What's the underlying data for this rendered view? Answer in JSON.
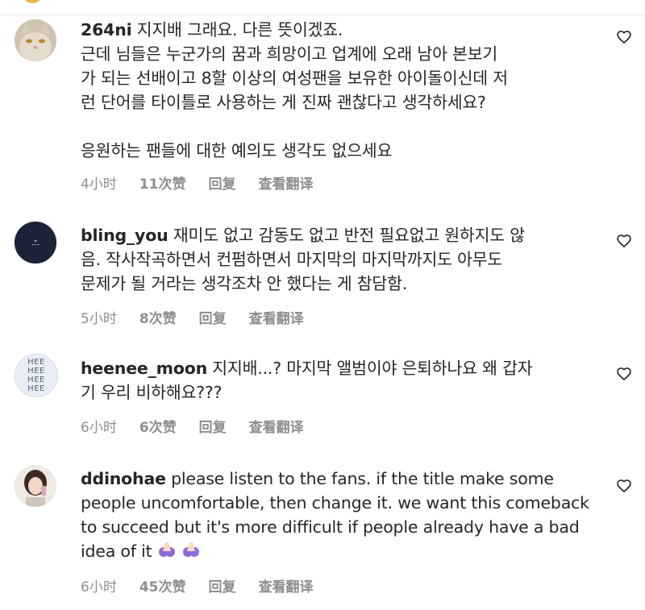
{
  "comments": [
    {
      "username": "264ni",
      "text": " 지지배 그래요. 다른 뜻이겠죠.\n근데 님들은 누군가의 꿈과 희망이고 업계에 오래 남아 본보기\n가 되는 선배이고 8할 이상의 여성팬을 보유한 아이돌이신데 저\n런 단어를 타이틀로 사용하는 게 진짜 괜찮다고 생각하세요?\n\n응원하는 팬들에 대한 예의도 생각도 없으세요",
      "time": "4小时",
      "likes": "11次赞",
      "reply": "回复",
      "translate": "查看翻译"
    },
    {
      "username": "bling_you",
      "text": " 재미도 없고 감동도 없고 반전 필요없고 원하지도 않\n음. 작사작곡하면서 컨펌하면서 마지막의 마지막까지도 아무도\n문제가 될 거라는 생각조차 안 했다는 게 참담함.",
      "time": "5小时",
      "likes": "8次赞",
      "reply": "回复",
      "translate": "查看翻译"
    },
    {
      "username": "heenee_moon",
      "text": " 지지배...? 마지막 앨범이야 은퇴하나요 왜 갑자\n기 우리 비하해요???",
      "time": "6小时",
      "likes": "6次赞",
      "reply": "回复",
      "translate": "查看翻译",
      "avatar_text": [
        "HEE",
        "HEE",
        "HEE",
        "HEE"
      ]
    },
    {
      "username": "ddinohae",
      "text": " please listen to the fans. if the title make some\npeople uncomfortable, then change it. we want this comeback\nto succeed but it's more difficult if people already have a bad\nidea of it ",
      "emoji": [
        "pleading-hands-emoji",
        "pleading-hands-emoji"
      ],
      "time": "6小时",
      "likes": "45次赞",
      "reply": "回复",
      "translate": "查看翻译"
    }
  ],
  "colors": {
    "text": "#262626",
    "meta": "#8e8e8e",
    "divider": "#ececec"
  }
}
